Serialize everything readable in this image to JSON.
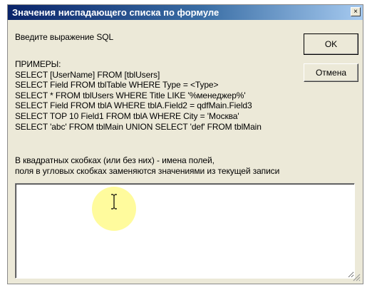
{
  "window": {
    "title": "Значения ниспадающего списка по формуле",
    "close_symbol": "×"
  },
  "prompt_label": "Введите выражение SQL",
  "buttons": {
    "ok": "OK",
    "cancel": "Отмена"
  },
  "examples": {
    "heading": "ПРИМЕРЫ:",
    "lines": [
      "SELECT [UserName] FROM [tblUsers]",
      "SELECT Field FROM tblTable WHERE Type = <Type>",
      "SELECT * FROM tblUsers WHERE Title LIKE '%менеджер%'",
      "SELECT Field FROM tblA WHERE tblA.Field2 = qdfMain.Field3",
      "SELECT TOP 10 Field1 FROM tblA WHERE City = 'Москва'",
      "SELECT 'abc' FROM tblMain UNION SELECT 'def' FROM tblMain"
    ]
  },
  "hint": {
    "line1": "В квадратных скобках (или без них) - имена полей,",
    "line2": "поля в угловых скобках заменяются значениями из текущей записи"
  },
  "sql_input": {
    "value": ""
  },
  "colors": {
    "title_bar_start": "#0a246a",
    "title_bar_end": "#a6caf0",
    "dialog_bg": "#ece9d8",
    "cursor_highlight": "#fffa8c"
  },
  "icons": {
    "cursor": "i-beam-cursor-icon",
    "grip": "resize-grip-icon"
  }
}
